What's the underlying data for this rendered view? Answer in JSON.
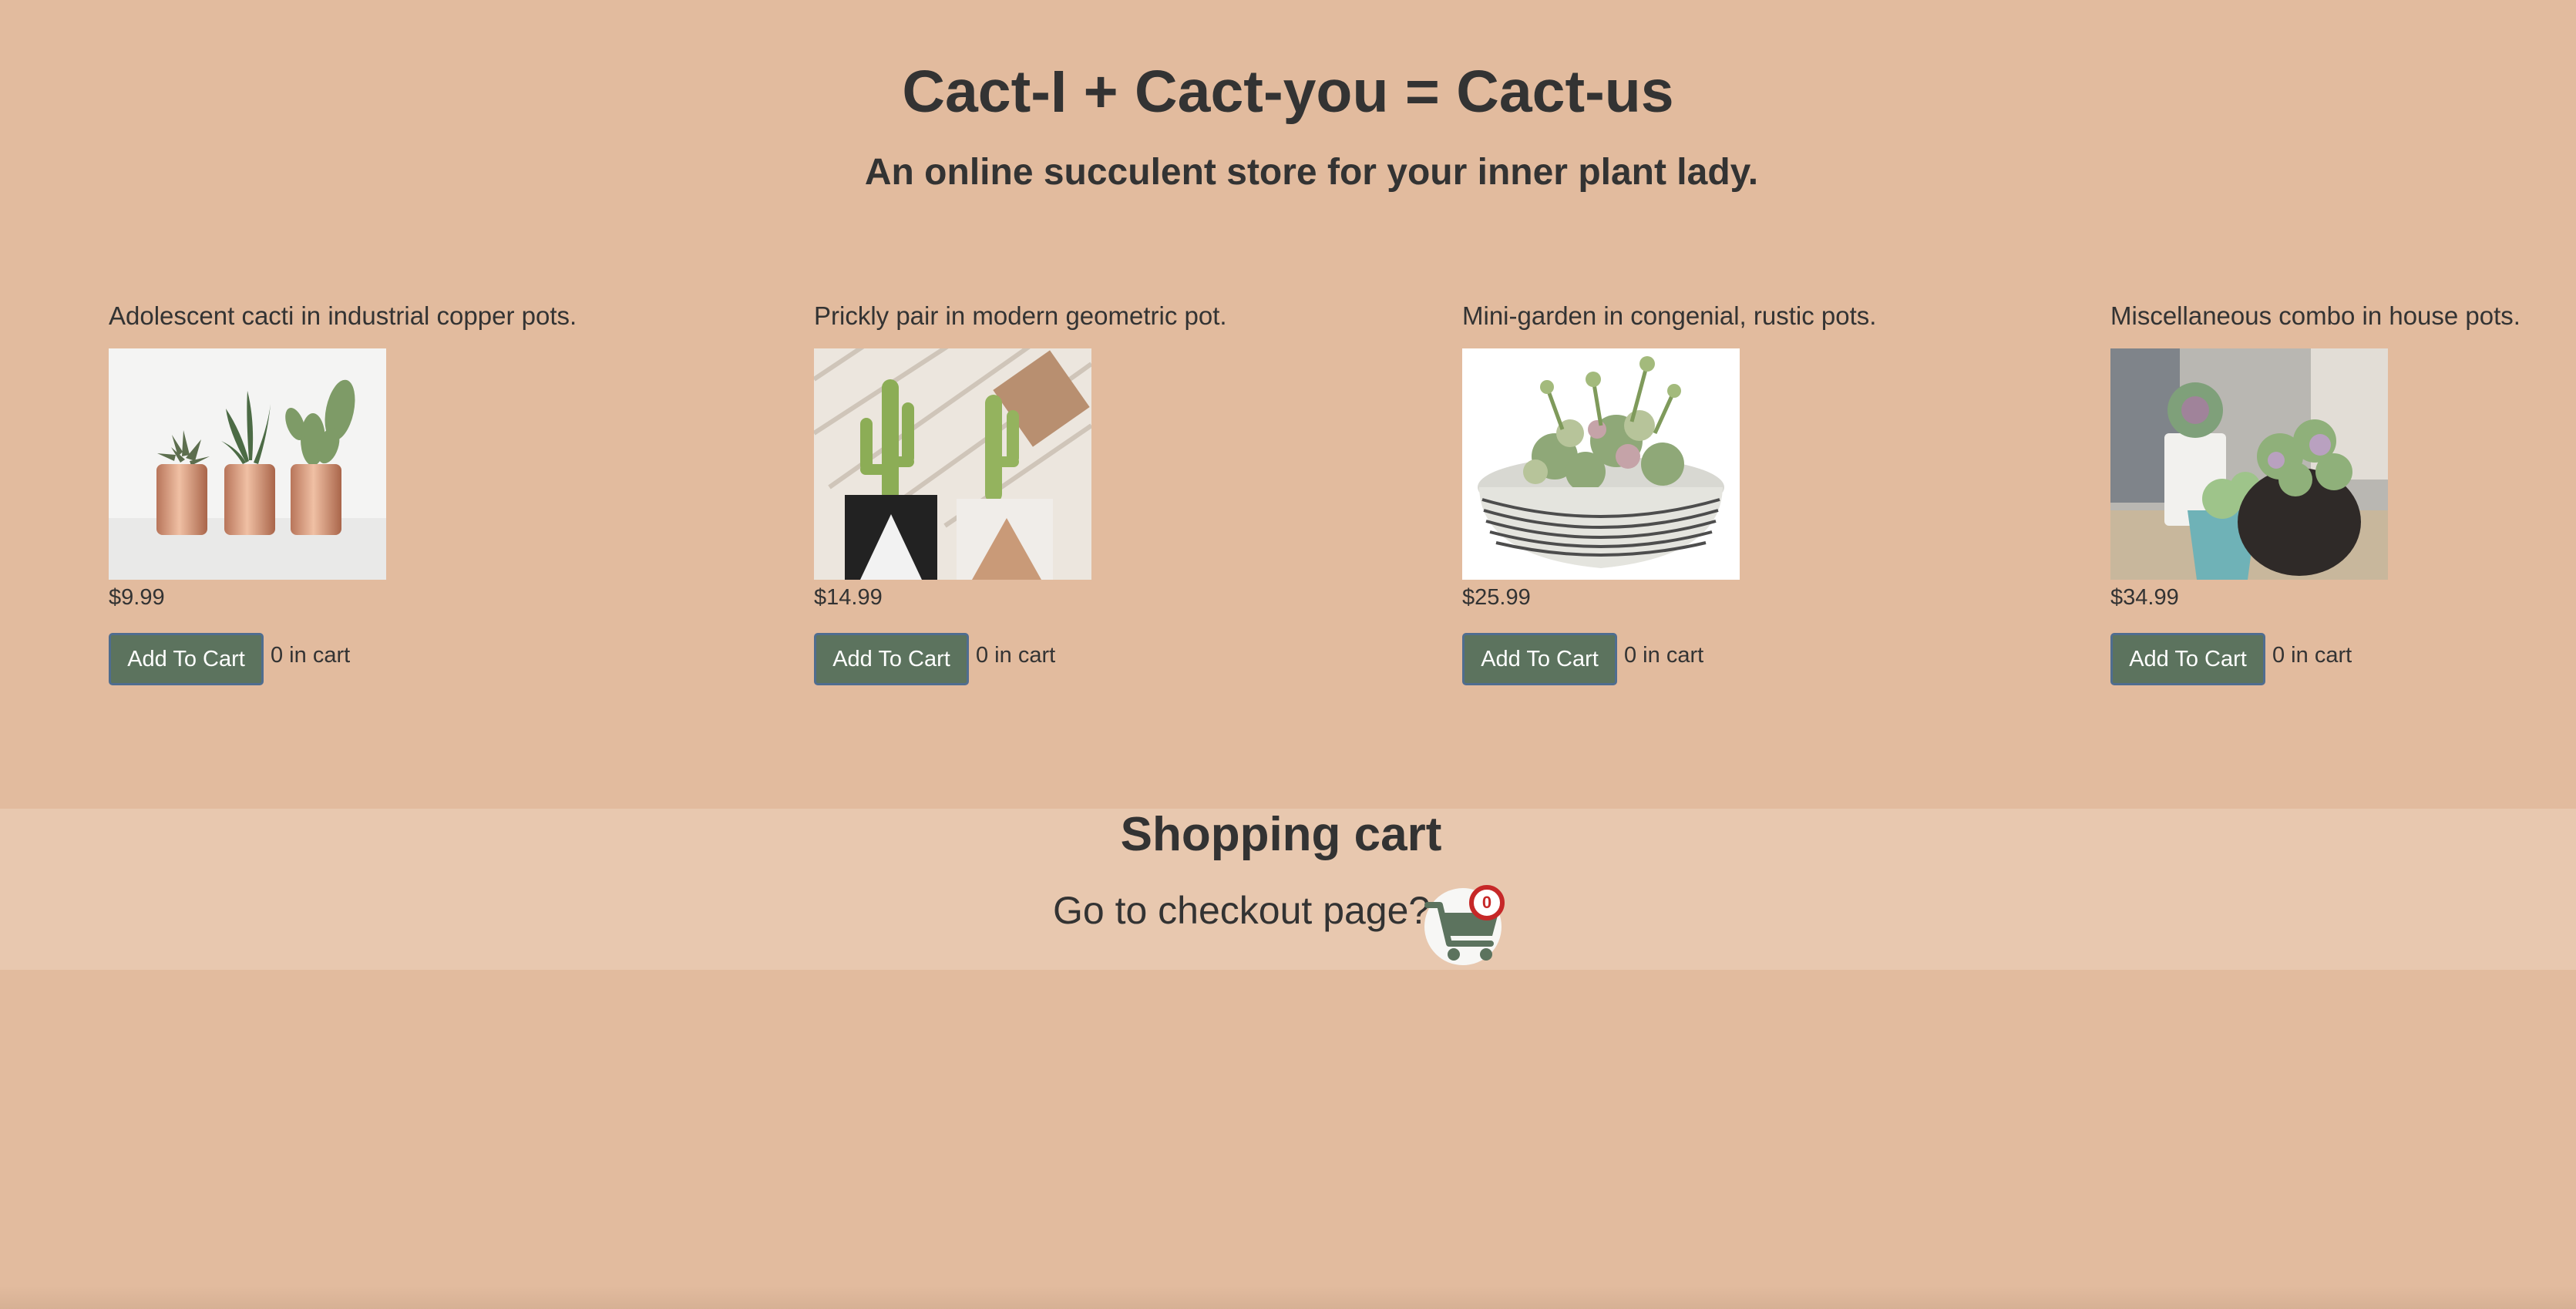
{
  "header": {
    "title": "Cact-I + Cact-you = Cact-us",
    "subtitle": "An online succulent store for your inner plant lady."
  },
  "products": [
    {
      "description": "Adolescent cacti in industrial copper pots.",
      "price": "$9.99",
      "add_label": "Add To Cart",
      "in_cart": "0 in cart",
      "image": "three-cacti-in-copper-pots"
    },
    {
      "description": "Prickly pair in modern geometric pot.",
      "price": "$14.99",
      "add_label": "Add To Cart",
      "in_cart": "0 in cart",
      "image": "two-cacti-in-geometric-pots"
    },
    {
      "description": "Mini-garden in congenial, rustic pots.",
      "price": "$25.99",
      "add_label": "Add To Cart",
      "in_cart": "0 in cart",
      "image": "succulent-garden-bowl"
    },
    {
      "description": "Miscellaneous combo in house pots.",
      "price": "$34.99",
      "add_label": "Add To Cart",
      "in_cart": "0 in cart",
      "image": "succulent-combo-pots"
    }
  ],
  "cart": {
    "heading": "Shopping cart",
    "checkout_prompt": "Go to checkout page?",
    "count": "0",
    "icon": "shopping-cart-icon"
  },
  "colors": {
    "page_background": "#e2bb9e",
    "cart_band": "#e8c8af",
    "button": "#5c735e",
    "badge": "#c62828",
    "text": "#333333"
  }
}
